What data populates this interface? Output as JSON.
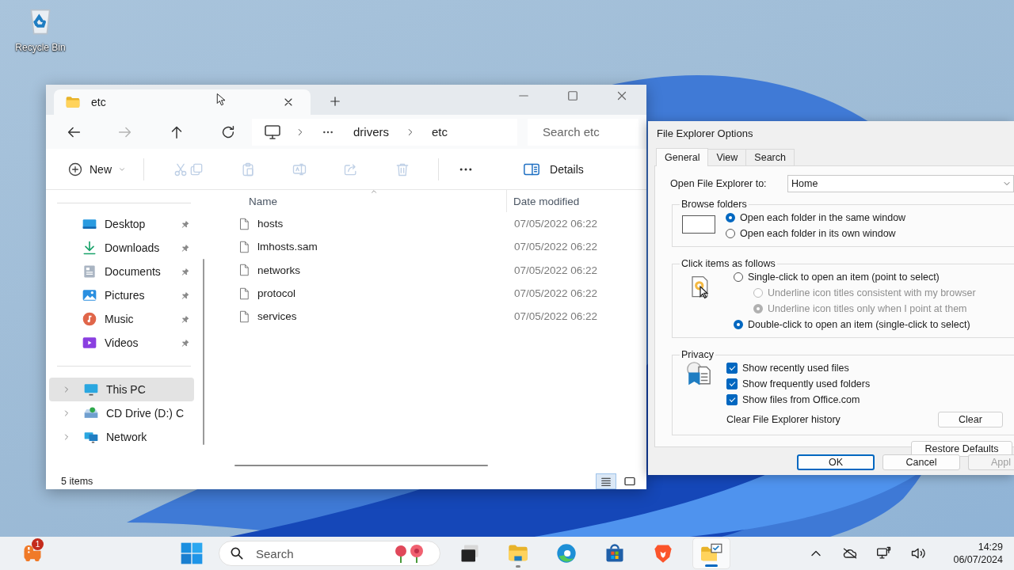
{
  "desktop": {
    "icons": [
      {
        "label": "Recycle Bin",
        "kind": "recycle-bin"
      }
    ]
  },
  "explorer": {
    "tabs": [
      {
        "title": "etc",
        "selected": true
      }
    ],
    "nav": [
      {
        "kind": "back",
        "disabled": false
      },
      {
        "kind": "forward",
        "disabled": true
      },
      {
        "kind": "up",
        "disabled": false
      },
      {
        "kind": "refresh",
        "disabled": false
      }
    ],
    "address": {
      "path": [
        "drivers",
        "etc"
      ]
    },
    "search": {
      "placeholder": "Search etc"
    },
    "commands": [
      {
        "kind": "new",
        "label": "New",
        "disabled": false
      },
      {
        "kind": "cut",
        "disabled": true
      },
      {
        "kind": "copy",
        "disabled": true
      },
      {
        "kind": "paste",
        "disabled": true
      },
      {
        "kind": "rename",
        "disabled": true
      },
      {
        "kind": "share",
        "disabled": true
      },
      {
        "kind": "delete",
        "disabled": true
      },
      {
        "kind": "more",
        "disabled": false
      },
      {
        "kind": "details",
        "label": "Details",
        "disabled": false
      }
    ],
    "sidebar": {
      "quick_access": [
        {
          "label": "Desktop",
          "kind": "desktop",
          "pinned": true
        },
        {
          "label": "Downloads",
          "kind": "downloads",
          "pinned": true
        },
        {
          "label": "Documents",
          "kind": "documents",
          "pinned": true
        },
        {
          "label": "Pictures",
          "kind": "pictures",
          "pinned": true
        },
        {
          "label": "Music",
          "kind": "music",
          "pinned": true
        },
        {
          "label": "Videos",
          "kind": "videos",
          "pinned": true
        }
      ],
      "locations": [
        {
          "label": "This PC",
          "kind": "pc",
          "selected": true
        },
        {
          "label": "CD Drive (D:) C",
          "kind": "cd",
          "selected": false
        },
        {
          "label": "Network",
          "kind": "network",
          "selected": false
        }
      ]
    },
    "table": {
      "columns": [
        {
          "label": "Name",
          "sorted": true
        },
        {
          "label": "Date modified",
          "sorted": false
        }
      ],
      "rows": [
        {
          "name": "hosts",
          "date_modified": "07/05/2022 06:22"
        },
        {
          "name": "lmhosts.sam",
          "date_modified": "07/05/2022 06:22"
        },
        {
          "name": "networks",
          "date_modified": "07/05/2022 06:22"
        },
        {
          "name": "protocol",
          "date_modified": "07/05/2022 06:22"
        },
        {
          "name": "services",
          "date_modified": "07/05/2022 06:22"
        }
      ]
    },
    "status": {
      "count": "5 items",
      "views": [
        {
          "kind": "details",
          "selected": true
        },
        {
          "kind": "tiles",
          "selected": false
        }
      ]
    }
  },
  "dialog": {
    "title": "File Explorer Options",
    "tabs": [
      {
        "label": "General",
        "selected": true
      },
      {
        "label": "View",
        "selected": false
      },
      {
        "label": "Search",
        "selected": false
      }
    ],
    "open_to": {
      "label": "Open File Explorer to:",
      "value": "Home"
    },
    "browse_folders": {
      "title": "Browse folders",
      "options": [
        {
          "label": "Open each folder in the same window",
          "selected": true
        },
        {
          "label": "Open each folder in its own window",
          "selected": false
        }
      ]
    },
    "click_items": {
      "title": "Click items as follows",
      "options": [
        {
          "label": "Single-click to open an item (point to select)",
          "selected": false,
          "disabled": false,
          "children": [
            {
              "label": "Underline icon titles consistent with my browser",
              "selected": false,
              "disabled": true
            },
            {
              "label": "Underline icon titles only when I point at them",
              "selected": true,
              "disabled": true
            }
          ]
        },
        {
          "label": "Double-click to open an item (single-click to select)",
          "selected": true,
          "disabled": false
        }
      ]
    },
    "privacy": {
      "title": "Privacy",
      "checkboxes": [
        {
          "label": "Show recently used files",
          "checked": true
        },
        {
          "label": "Show frequently used folders",
          "checked": true
        },
        {
          "label": "Show files from Office.com",
          "checked": true
        }
      ],
      "clear_label": "Clear File Explorer history",
      "clear_button": "Clear"
    },
    "restore_button": "Restore Defaults",
    "buttons": [
      {
        "label": "OK",
        "default": true,
        "disabled": false
      },
      {
        "label": "Cancel",
        "default": false,
        "disabled": false
      },
      {
        "label": "Appl",
        "default": false,
        "disabled": true
      }
    ]
  },
  "taskbar": {
    "notification_badge": "1",
    "search": {
      "placeholder": "Search"
    },
    "apps": [
      {
        "kind": "task-view",
        "running": false,
        "active": false
      },
      {
        "kind": "explorer",
        "running": true,
        "active": false
      },
      {
        "kind": "edge",
        "running": false,
        "active": false
      },
      {
        "kind": "store",
        "running": false,
        "active": false
      },
      {
        "kind": "brave",
        "running": false,
        "active": false
      },
      {
        "kind": "options",
        "running": true,
        "active": true
      }
    ],
    "clock": {
      "time": "14:29",
      "date": "06/07/2024"
    }
  }
}
